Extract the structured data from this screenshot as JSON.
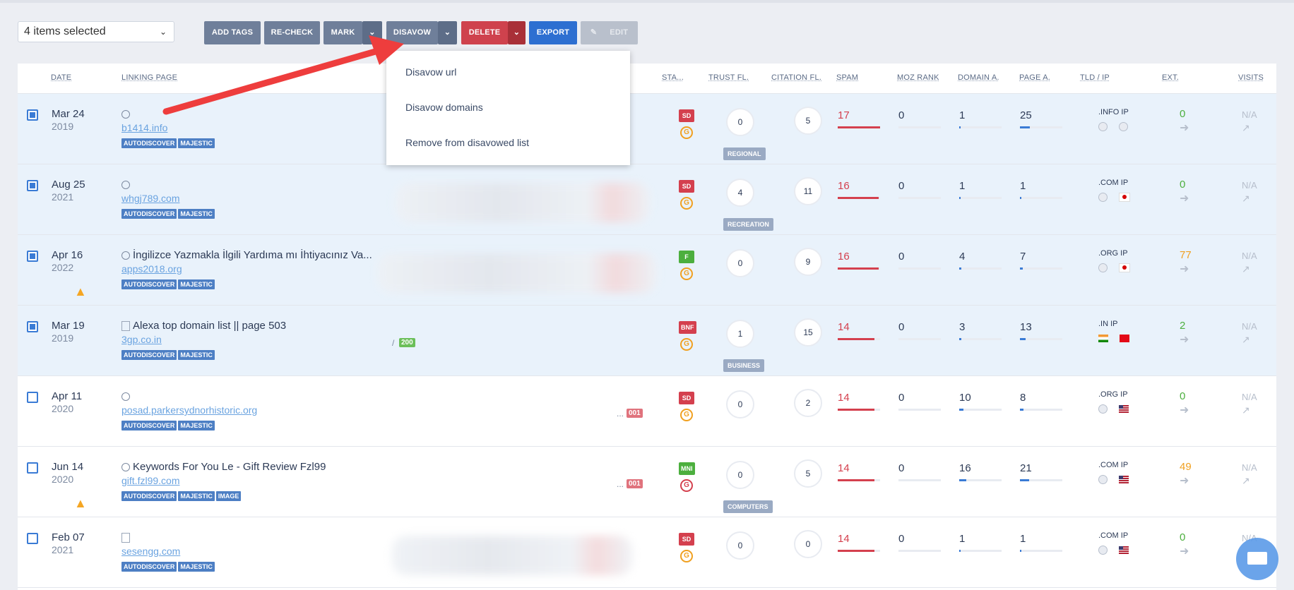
{
  "toolbar": {
    "selection": "4 items selected",
    "add_tags": "ADD TAGS",
    "recheck": "RE-CHECK",
    "mark": "MARK",
    "disavow": "DISAVOW",
    "delete": "DELETE",
    "export": "EXPORT",
    "edit": "EDIT"
  },
  "columns": {
    "date": "DATE",
    "linking_page": "LINKING PAGE",
    "status": "STA...",
    "trust": "TRUST FL.",
    "citation": "CITATION FL.",
    "spam": "SPAM",
    "moz": "MOZ RANK",
    "domain_a": "DOMAIN A.",
    "page_a": "PAGE A.",
    "tld": "TLD / IP",
    "ext": "EXT.",
    "visits": "VISITS"
  },
  "disavow_menu": [
    "Disavow url",
    "Disavow domains",
    "Remove from disavowed list"
  ],
  "rows": [
    {
      "date": "Mar 24",
      "year": "2019",
      "title": "",
      "domain": "b1414.info",
      "tags": [
        "AUTODISCOVER",
        "MAJESTIC"
      ],
      "status": "SD",
      "trust": "0",
      "topic": "REGIONAL",
      "citation": "5",
      "spam": "17",
      "moz": "0",
      "domain_a": "1",
      "page_a": "25",
      "tld": ".INFO IP",
      "ext": "0",
      "visits": "N/A"
    },
    {
      "date": "Aug 25",
      "year": "2021",
      "title": "",
      "domain": "whgj789.com",
      "tags": [
        "AUTODISCOVER",
        "MAJESTIC"
      ],
      "status": "SD",
      "trust": "4",
      "topic": "RECREATION",
      "citation": "11",
      "spam": "16",
      "moz": "0",
      "domain_a": "1",
      "page_a": "1",
      "tld": ".COM IP",
      "ext": "0",
      "visits": "N/A"
    },
    {
      "date": "Apr 16",
      "year": "2022",
      "title": "İngilizce Yazmakla İlgili Yardıma mı İhtiyacınız Va...",
      "domain": "apps2018.org",
      "tags": [
        "AUTODISCOVER",
        "MAJESTIC"
      ],
      "status": "F",
      "trust": "0",
      "topic": "",
      "citation": "9",
      "spam": "16",
      "moz": "0",
      "domain_a": "4",
      "page_a": "7",
      "tld": ".ORG IP",
      "ext": "77",
      "visits": "N/A"
    },
    {
      "date": "Mar 19",
      "year": "2019",
      "title": "Alexa top domain list || page 503",
      "domain": "3gp.co.in",
      "tags": [
        "AUTODISCOVER",
        "MAJESTIC"
      ],
      "status": "BNF",
      "trust": "1",
      "topic": "BUSINESS",
      "citation": "15",
      "spam": "14",
      "moz": "0",
      "domain_a": "3",
      "page_a": "13",
      "tld": ".IN  IP",
      "ext": "2",
      "visits": "N/A",
      "code": "200",
      "sep": "/"
    },
    {
      "date": "Apr 11",
      "year": "2020",
      "title": "",
      "domain": "posad.parkersydnorhistoric.org",
      "tags": [
        "AUTODISCOVER",
        "MAJESTIC"
      ],
      "status": "SD",
      "trust": "0",
      "topic": "",
      "citation": "2",
      "spam": "14",
      "moz": "0",
      "domain_a": "10",
      "page_a": "8",
      "tld": ".ORG IP",
      "ext": "0",
      "visits": "N/A",
      "code": "001",
      "sep": "..."
    },
    {
      "date": "Jun 14",
      "year": "2020",
      "title": "Keywords For You Le - Gift Review Fzl99",
      "domain": "gift.fzl99.com",
      "tags": [
        "AUTODISCOVER",
        "MAJESTIC",
        "IMAGE"
      ],
      "status": "MNI",
      "trust": "0",
      "topic": "COMPUTERS",
      "citation": "5",
      "spam": "14",
      "moz": "0",
      "domain_a": "16",
      "page_a": "21",
      "tld": ".COM IP",
      "ext": "49",
      "visits": "N/A",
      "code": "001",
      "sep": "..."
    },
    {
      "date": "Feb 07",
      "year": "2021",
      "title": "",
      "domain": "sesengg.com",
      "tags": [
        "AUTODISCOVER",
        "MAJESTIC"
      ],
      "status": "SD",
      "trust": "0",
      "topic": "",
      "citation": "0",
      "spam": "14",
      "moz": "0",
      "domain_a": "1",
      "page_a": "1",
      "tld": ".COM IP",
      "ext": "0",
      "visits": "N/A"
    }
  ]
}
